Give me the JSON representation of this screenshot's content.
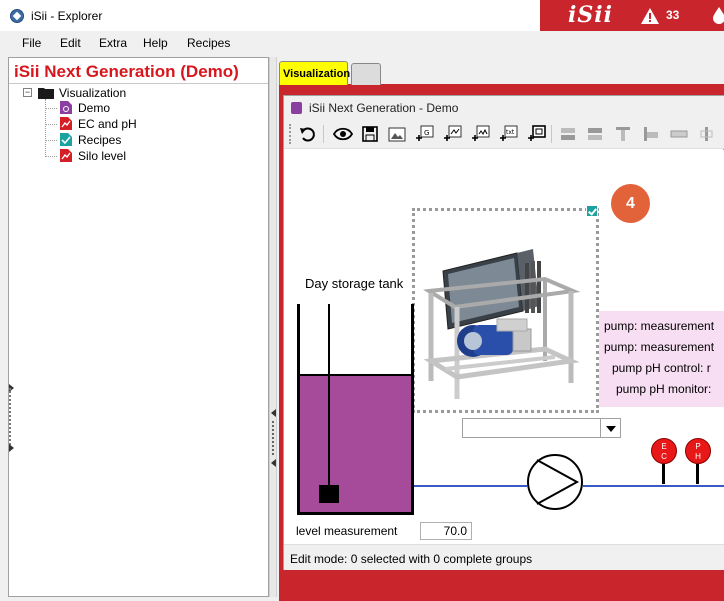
{
  "window": {
    "title": "iSii - Explorer",
    "brand": "iSii",
    "alert_count": "33"
  },
  "menu": [
    "File",
    "Edit",
    "Extra",
    "Help",
    "Recipes"
  ],
  "explorer": {
    "panel_title": "iSii Next Generation (Demo)",
    "root": {
      "label": "Visualization",
      "toggle": "−"
    },
    "children": [
      {
        "label": "Demo",
        "icon": "visualization-doc-icon"
      },
      {
        "label": "EC and pH",
        "icon": "trend-chart-icon"
      },
      {
        "label": "Recipes",
        "icon": "recipe-check-icon"
      },
      {
        "label": "Silo level",
        "icon": "trend-chart-icon"
      }
    ]
  },
  "tabs": {
    "active": "Visualization",
    "inactive": ""
  },
  "editor": {
    "title": "iSii Next Generation - Demo",
    "toolbar": [
      "undo-icon",
      "eye-icon",
      "save-icon",
      "image-icon",
      "add-group-icon",
      "add-trend-icon",
      "add-chart-icon",
      "add-text-icon",
      "add-frame-icon",
      "align-top-icon",
      "align-bottom-icon",
      "align-left-icon",
      "align-center-icon",
      "distribute-icon",
      "align-right-icon"
    ],
    "selection_count": "4",
    "tank_label": "Day storage tank",
    "tank_fill_fraction": 0.66,
    "pink_panel_lines": [
      "pump: measurement",
      "pump: measurement",
      "pump pH control: r",
      "pump pH monitor:"
    ],
    "dropdown_value": "",
    "sensors": [
      {
        "label_top": "E",
        "label_bottom": "C"
      },
      {
        "label_top": "P",
        "label_bottom": "H"
      }
    ],
    "level_label": "level measurement",
    "level_value": "70.0",
    "status": "Edit mode: 0 selected with 0 complete groups"
  },
  "colors": {
    "accent_red": "#c8262c",
    "active_tab": "#ffff00",
    "tank_liquid": "#a64a9a",
    "pipe": "#3a5bc7",
    "badge": "#e2623a",
    "panel_title": "#d7171d"
  }
}
